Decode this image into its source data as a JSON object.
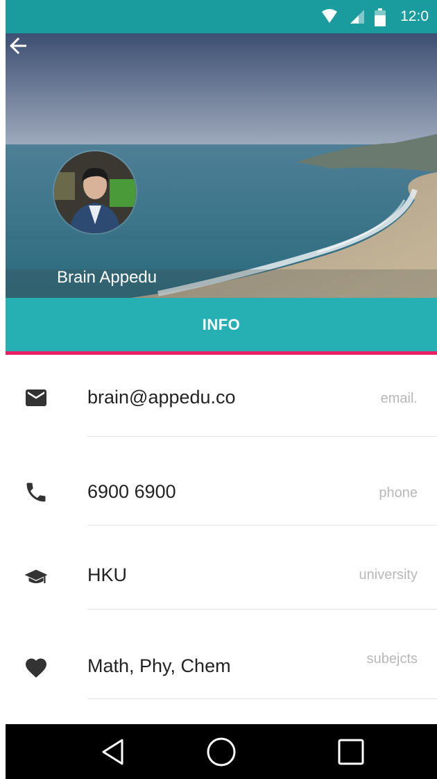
{
  "status_bar": {
    "time": "12:0",
    "icons": [
      "wifi-icon",
      "signal-icon",
      "battery-icon"
    ]
  },
  "header": {
    "back_icon": "arrow-left-icon",
    "name": "Brain Appedu"
  },
  "tabs": [
    {
      "label": "INFO",
      "selected": true
    }
  ],
  "info": [
    {
      "icon": "email-icon",
      "value": "brain@appedu.co",
      "label": "email."
    },
    {
      "icon": "phone-icon",
      "value": "6900 6900",
      "label": "phone"
    },
    {
      "icon": "graduation-cap-icon",
      "value": "HKU",
      "label": "university"
    },
    {
      "icon": "heart-icon",
      "value": "Math, Phy, Chem",
      "label": "subejcts"
    }
  ],
  "nav": [
    "back-triangle-icon",
    "home-circle-icon",
    "recents-square-icon"
  ],
  "colors": {
    "status_bar": "#1a9b9e",
    "tab_bar": "#26b0b3",
    "tab_indicator": "#e91e63",
    "nav_bar": "#000000"
  }
}
